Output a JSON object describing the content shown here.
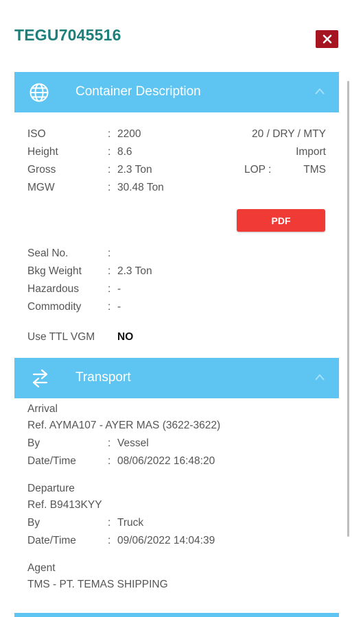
{
  "header": {
    "container_id": "TEGU7045516"
  },
  "container_section": {
    "title": "Container Description",
    "rows_left": [
      {
        "label": "ISO",
        "value": "2200"
      },
      {
        "label": "Height",
        "value": "8.6"
      },
      {
        "label": "Gross",
        "value": "2.3 Ton"
      },
      {
        "label": "MGW",
        "value": "30.48 Ton"
      }
    ],
    "type_summary": "20 / DRY / MTY",
    "movement": "Import",
    "lop_label": "LOP :",
    "lop_value": "TMS",
    "pdf_label": "PDF",
    "rows_bottom": [
      {
        "label": "Seal No.",
        "value": ""
      },
      {
        "label": "Bkg Weight",
        "value": "2.3 Ton"
      },
      {
        "label": "Hazardous",
        "value": "-"
      },
      {
        "label": "Commodity",
        "value": "-"
      }
    ],
    "ttl_vgm_label": "Use TTL VGM",
    "ttl_vgm_value": "NO"
  },
  "transport_section": {
    "title": "Transport",
    "arrival": {
      "heading": "Arrival",
      "ref": "Ref. AYMA107 - AYER MAS (3622-3622)",
      "by_label": "By",
      "by_value": "Vessel",
      "datetime_label": "Date/Time",
      "datetime_value": "08/06/2022 16:48:20"
    },
    "departure": {
      "heading": "Departure",
      "ref": "Ref. B9413KYY",
      "by_label": "By",
      "by_value": "Truck",
      "datetime_label": "Date/Time",
      "datetime_value": "09/06/2022 14:04:39"
    },
    "agent": {
      "heading": "Agent",
      "value": "TMS - PT. TEMAS SHIPPING"
    }
  },
  "colon": ":",
  "icons": {
    "close": "close-icon",
    "globe": "globe-icon",
    "transfer": "transfer-arrows-icon",
    "collapse": "chevron-up-icon"
  },
  "colors": {
    "accent": "#5ec4f2",
    "title": "#1f7f7a",
    "close_bg": "#a51420",
    "pdf_bg": "#f03a35"
  }
}
